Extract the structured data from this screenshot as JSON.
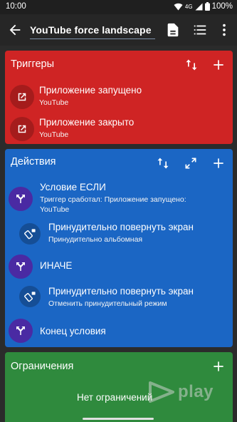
{
  "status_bar": {
    "time": "10:00",
    "network": "4G",
    "battery": "100%"
  },
  "app_bar": {
    "title": "YouTube force landscape"
  },
  "triggers": {
    "title": "Триггеры",
    "items": [
      {
        "label": "Приложение запущено",
        "sub": "YouTube",
        "icon": "open-external-icon"
      },
      {
        "label": "Приложение закрыто",
        "sub": "YouTube",
        "icon": "open-external-icon"
      }
    ]
  },
  "actions": {
    "title": "Действия",
    "items": [
      {
        "label": "Условие ЕСЛИ",
        "sub": "Триггер сработал: Приложение запущено:",
        "sub2": "YouTube",
        "icon": "split-icon"
      },
      {
        "label": "Принудительно повернуть экран",
        "sub": "Принудительно альбомная",
        "icon": "rotate-lock-icon"
      },
      {
        "label": "ИНАЧЕ",
        "icon": "split-icon"
      },
      {
        "label": "Принудительно повернуть экран",
        "sub": "Отменить принудительный режим",
        "icon": "rotate-lock-icon"
      },
      {
        "label": "Конец условия",
        "icon": "split-icon"
      }
    ]
  },
  "constraints": {
    "title": "Ограничения",
    "empty_text": "Нет ограничений"
  },
  "watermark": {
    "text": "play"
  },
  "colors": {
    "triggers": "#cf2424",
    "actions": "#1b66c4",
    "constraints": "#2f8a3d",
    "app_bar": "#262626"
  }
}
